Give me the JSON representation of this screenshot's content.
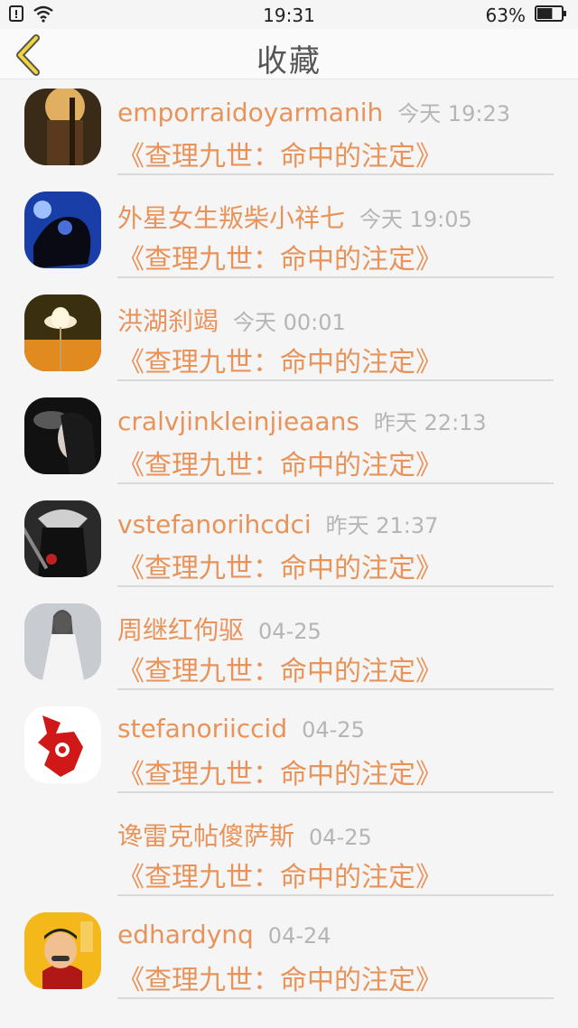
{
  "status_bar": {
    "time": "19:31",
    "battery": "63%",
    "battery_level": 0.63
  },
  "nav": {
    "title": "收藏"
  },
  "items": [
    {
      "username": "emporraidoyarmanih",
      "time": "今天 19:23",
      "book": "《查理九世：命中的注定》",
      "avatar": "dark-warm-photo"
    },
    {
      "username": "外星女生叛柴小祥七",
      "time": "今天 19:05",
      "book": "《查理九世：命中的注定》",
      "avatar": "blue-silhouette"
    },
    {
      "username": "洪湖刹竭",
      "time": "今天 00:01",
      "book": "《查理九世：命中的注定》",
      "avatar": "flower-photo"
    },
    {
      "username": "cralvjinkleinjieaans",
      "time": "昨天 22:13",
      "book": "《查理九世：命中的注定》",
      "avatar": "smoking-portrait"
    },
    {
      "username": "vstefanorihcdci",
      "time": "昨天 21:37",
      "book": "《查理九世：命中的注定》",
      "avatar": "dark-warrior"
    },
    {
      "username": "周继红佝驱",
      "time": "04-25",
      "book": "《查理九世：命中的注定》",
      "avatar": "anime-figure"
    },
    {
      "username": "stefanoriiccid",
      "time": "04-25",
      "book": "《查理九世：命中的注定》",
      "avatar": "red-papercut"
    },
    {
      "username": "谗雷克帖傻萨斯",
      "time": "04-25",
      "book": "《查理九世：命中的注定》",
      "avatar": ""
    },
    {
      "username": "edhardynq",
      "time": "04-24",
      "book": "《查理九世：命中的注定》",
      "avatar": "cartoon-man"
    }
  ]
}
